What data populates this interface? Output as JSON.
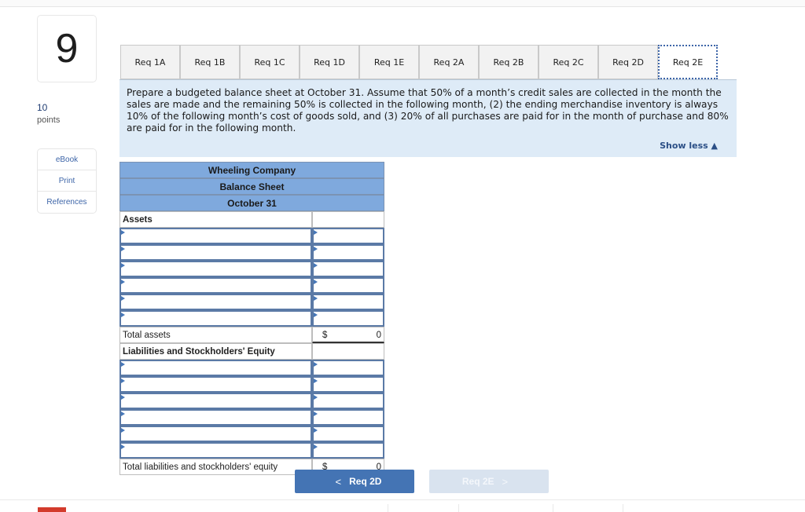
{
  "question": {
    "number": "9",
    "points_value": "10",
    "points_label": "points"
  },
  "side_links": [
    "eBook",
    "Print",
    "References"
  ],
  "tabs": [
    {
      "label": "Req 1A",
      "active": false
    },
    {
      "label": "Req 1B",
      "active": false
    },
    {
      "label": "Req 1C",
      "active": false
    },
    {
      "label": "Req 1D",
      "active": false
    },
    {
      "label": "Req 1E",
      "active": false
    },
    {
      "label": "Req 2A",
      "active": false
    },
    {
      "label": "Req 2B",
      "active": false
    },
    {
      "label": "Req 2C",
      "active": false
    },
    {
      "label": "Req 2D",
      "active": false
    },
    {
      "label": "Req 2E",
      "active": true
    }
  ],
  "instructions": {
    "text": "Prepare a budgeted balance sheet at October 31. Assume that 50% of a month’s credit sales are collected in the month the sales are made and the remaining 50% is collected in the following month, (2) the ending merchandise inventory is always 10% of the following month’s cost of goods sold, and (3) 20% of all purchases are paid for in the month of purchase and 80% are paid for in the following month.",
    "show_less": "Show less ▲"
  },
  "balance_sheet": {
    "company": "Wheeling Company",
    "title": "Balance Sheet",
    "date": "October 31",
    "assets_label": "Assets",
    "asset_rows": [
      "",
      "",
      "",
      "",
      "",
      ""
    ],
    "total_assets_label": "Total assets",
    "total_assets_currency": "$",
    "total_assets_value": "0",
    "liabilities_label": "Liabilities and Stockholders' Equity",
    "liability_rows": [
      "",
      "",
      "",
      "",
      "",
      ""
    ],
    "total_liabilities_label": "Total liabilities and stockholders' equity",
    "total_liabilities_currency": "$",
    "total_liabilities_value": "0"
  },
  "navigation": {
    "prev_label": "Req 2D",
    "next_label": "Req 2E",
    "prev_chevron": "<",
    "next_chevron": ">"
  }
}
